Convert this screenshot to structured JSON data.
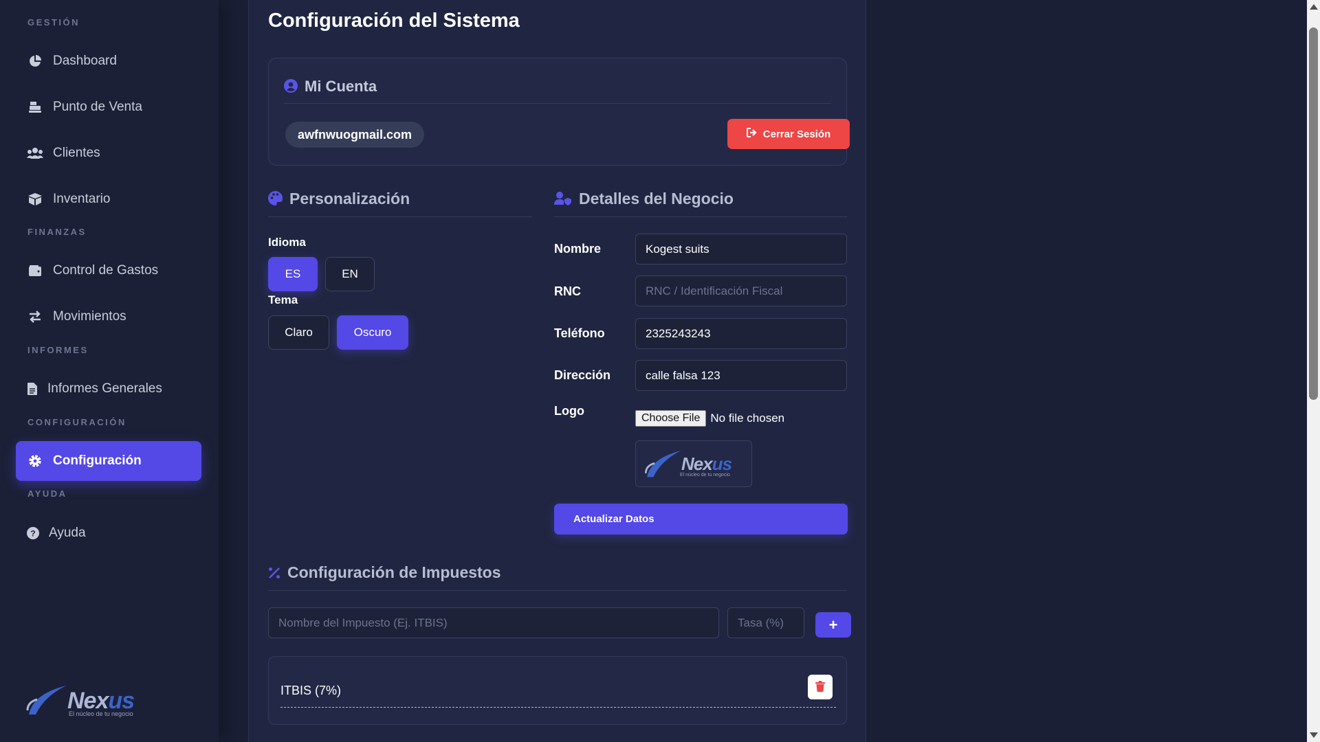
{
  "sidebar": {
    "sections": {
      "gestion": "GESTIÓN",
      "finanzas": "FINANZAS",
      "informes": "INFORMES",
      "configuracion": "CONFIGURACIÓN",
      "ayuda": "AYUDA"
    },
    "items": {
      "dashboard": "Dashboard",
      "pos": "Punto de Venta",
      "clientes": "Clientes",
      "inventario": "Inventario",
      "gastos": "Control de Gastos",
      "movimientos": "Movimientos",
      "informes": "Informes Generales",
      "configuracion": "Configuración",
      "ayuda": "Ayuda"
    },
    "logo": {
      "text_a": "Nex",
      "text_b": "us",
      "tagline": "El núcleo de tu negocio"
    }
  },
  "main": {
    "title": "Configuración del Sistema",
    "account": {
      "title": "Mi Cuenta",
      "email": "awfnwuogmail.com",
      "logout_label": "Cerrar Sesión"
    },
    "personalization": {
      "title": "Personalización",
      "language_label": "Idioma",
      "lang_es": "ES",
      "lang_en": "EN",
      "theme_label": "Tema",
      "theme_light": "Claro",
      "theme_dark": "Oscuro"
    },
    "business": {
      "title": "Detalles del Negocio",
      "name_label": "Nombre",
      "name_value": "Kogest suits",
      "rnc_label": "RNC",
      "rnc_placeholder": "RNC / Identificación Fiscal",
      "phone_label": "Teléfono",
      "phone_value": "2325243243",
      "address_label": "Dirección",
      "address_value": "calle falsa 123",
      "logo_label": "Logo",
      "file_button": "Choose File",
      "file_status": "No file chosen",
      "update_label": "Actualizar Datos"
    },
    "taxes": {
      "title": "Configuración de Impuestos",
      "name_placeholder": "Nombre del Impuesto (Ej. ITBIS)",
      "rate_placeholder": "Tasa (%)",
      "add_label": "+",
      "items": [
        {
          "label": "ITBIS (7%)"
        }
      ]
    }
  },
  "colors": {
    "accent": "#5448e6",
    "danger": "#ee4545",
    "background": "#1a1f36",
    "panel": "#202641"
  }
}
